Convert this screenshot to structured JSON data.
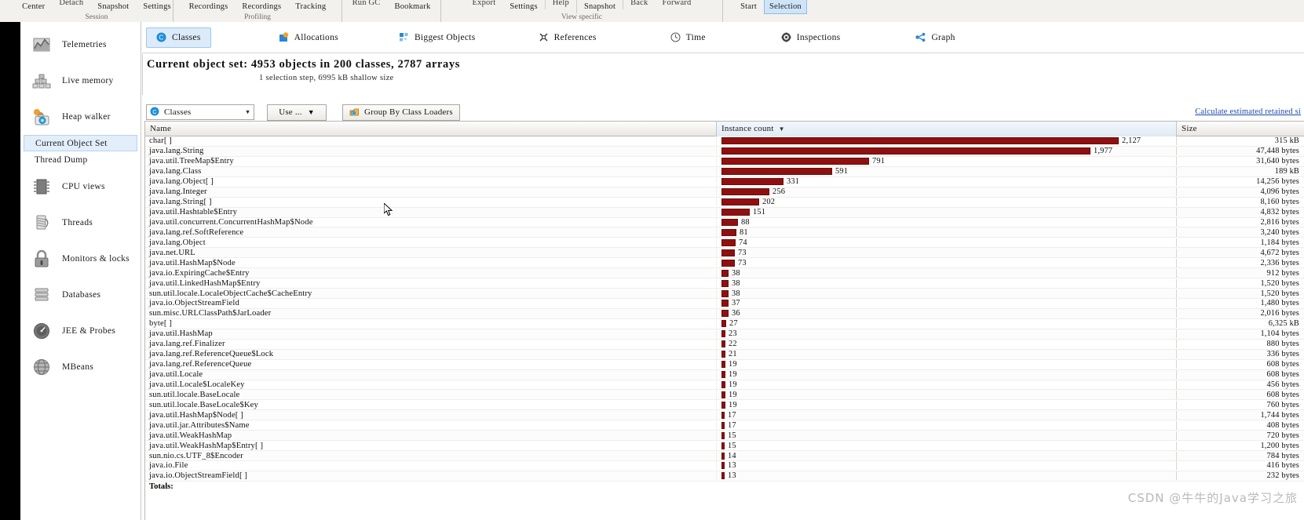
{
  "ribbon": {
    "groups": [
      {
        "label": "Session",
        "buttons": [
          "Center",
          "Detach",
          "Snapshot",
          "Settings"
        ]
      },
      {
        "label": "Profiling",
        "buttons": [
          "Recordings",
          "Recordings",
          "Tracking"
        ]
      },
      {
        "label": "",
        "buttons": [
          "Run GC",
          "Bookmark"
        ]
      },
      {
        "label": "View specific",
        "buttons": [
          "Export",
          "Settings",
          "Help",
          "Snapshot",
          "Back",
          "Forward"
        ]
      },
      {
        "label": "",
        "buttons": [
          "Start",
          "Selection"
        ]
      }
    ],
    "selected_button": "Selection"
  },
  "sidebar": {
    "items": [
      {
        "label": "Telemetries",
        "icon": "telemetries-icon"
      },
      {
        "label": "Live memory",
        "icon": "live-memory-icon"
      },
      {
        "label": "Heap walker",
        "icon": "heap-walker-icon"
      },
      {
        "label": "CPU views",
        "icon": "cpu-views-icon"
      },
      {
        "label": "Threads",
        "icon": "threads-icon"
      },
      {
        "label": "Monitors & locks",
        "icon": "monitors-locks-icon"
      },
      {
        "label": "Databases",
        "icon": "databases-icon"
      },
      {
        "label": "JEE & Probes",
        "icon": "jee-probes-icon"
      },
      {
        "label": "MBeans",
        "icon": "mbeans-icon"
      }
    ],
    "subitems": [
      {
        "label": "Current Object Set",
        "active": true
      },
      {
        "label": "Thread Dump",
        "active": false
      }
    ]
  },
  "tabs": [
    {
      "label": "Classes",
      "icon": "classes-icon",
      "active": true
    },
    {
      "label": "Allocations",
      "icon": "allocations-icon",
      "active": false
    },
    {
      "label": "Biggest Objects",
      "icon": "biggest-objects-icon",
      "active": false
    },
    {
      "label": "References",
      "icon": "references-icon",
      "active": false
    },
    {
      "label": "Time",
      "icon": "clock-icon",
      "active": false
    },
    {
      "label": "Inspections",
      "icon": "gear-icon",
      "active": false
    },
    {
      "label": "Graph",
      "icon": "graph-icon",
      "active": false
    }
  ],
  "header": {
    "title": "Current object set: 4953 objects in 200 classes, 2787 arrays",
    "subtitle": "1 selection step, 6995 kB shallow size"
  },
  "controls": {
    "view_select": {
      "value": "Classes",
      "icon": "class-icon"
    },
    "use_button": {
      "label": "Use ...",
      "icon": "chevron-down-icon"
    },
    "group_button": {
      "label": "Group By Class Loaders",
      "icon": "classloader-icon"
    },
    "calculate_link": "Calculate estimated retained si"
  },
  "table": {
    "columns": [
      "Name",
      "Instance count",
      "Size"
    ],
    "sort_column": "Instance count",
    "sort_direction": "desc",
    "max_count": 2127,
    "rows": [
      {
        "name": "char[ ]",
        "count": 2127,
        "count_label": "2,127",
        "size": "315 kB"
      },
      {
        "name": "java.lang.String",
        "count": 1977,
        "count_label": "1,977",
        "size": "47,448 bytes"
      },
      {
        "name": "java.util.TreeMap$Entry",
        "count": 791,
        "count_label": "791",
        "size": "31,640 bytes"
      },
      {
        "name": "java.lang.Class",
        "count": 591,
        "count_label": "591",
        "size": "189 kB"
      },
      {
        "name": "java.lang.Object[ ]",
        "count": 331,
        "count_label": "331",
        "size": "14,256 bytes"
      },
      {
        "name": "java.lang.Integer",
        "count": 256,
        "count_label": "256",
        "size": "4,096 bytes"
      },
      {
        "name": "java.lang.String[ ]",
        "count": 202,
        "count_label": "202",
        "size": "8,160 bytes"
      },
      {
        "name": "java.util.Hashtable$Entry",
        "count": 151,
        "count_label": "151",
        "size": "4,832 bytes"
      },
      {
        "name": "java.util.concurrent.ConcurrentHashMap$Node",
        "count": 88,
        "count_label": "88",
        "size": "2,816 bytes"
      },
      {
        "name": "java.lang.ref.SoftReference",
        "count": 81,
        "count_label": "81",
        "size": "3,240 bytes"
      },
      {
        "name": "java.lang.Object",
        "count": 74,
        "count_label": "74",
        "size": "1,184 bytes"
      },
      {
        "name": "java.net.URL",
        "count": 73,
        "count_label": "73",
        "size": "4,672 bytes"
      },
      {
        "name": "java.util.HashMap$Node",
        "count": 73,
        "count_label": "73",
        "size": "2,336 bytes"
      },
      {
        "name": "java.io.ExpiringCache$Entry",
        "count": 38,
        "count_label": "38",
        "size": "912 bytes"
      },
      {
        "name": "java.util.LinkedHashMap$Entry",
        "count": 38,
        "count_label": "38",
        "size": "1,520 bytes"
      },
      {
        "name": "sun.util.locale.LocaleObjectCache$CacheEntry",
        "count": 38,
        "count_label": "38",
        "size": "1,520 bytes"
      },
      {
        "name": "java.io.ObjectStreamField",
        "count": 37,
        "count_label": "37",
        "size": "1,480 bytes"
      },
      {
        "name": "sun.misc.URLClassPath$JarLoader",
        "count": 36,
        "count_label": "36",
        "size": "2,016 bytes"
      },
      {
        "name": "byte[ ]",
        "count": 27,
        "count_label": "27",
        "size": "6,325 kB"
      },
      {
        "name": "java.util.HashMap",
        "count": 23,
        "count_label": "23",
        "size": "1,104 bytes"
      },
      {
        "name": "java.lang.ref.Finalizer",
        "count": 22,
        "count_label": "22",
        "size": "880 bytes"
      },
      {
        "name": "java.lang.ref.ReferenceQueue$Lock",
        "count": 21,
        "count_label": "21",
        "size": "336 bytes"
      },
      {
        "name": "java.lang.ref.ReferenceQueue",
        "count": 19,
        "count_label": "19",
        "size": "608 bytes"
      },
      {
        "name": "java.util.Locale",
        "count": 19,
        "count_label": "19",
        "size": "608 bytes"
      },
      {
        "name": "java.util.Locale$LocaleKey",
        "count": 19,
        "count_label": "19",
        "size": "456 bytes"
      },
      {
        "name": "sun.util.locale.BaseLocale",
        "count": 19,
        "count_label": "19",
        "size": "608 bytes"
      },
      {
        "name": "sun.util.locale.BaseLocale$Key",
        "count": 19,
        "count_label": "19",
        "size": "760 bytes"
      },
      {
        "name": "java.util.HashMap$Node[ ]",
        "count": 17,
        "count_label": "17",
        "size": "1,744 bytes"
      },
      {
        "name": "java.util.jar.Attributes$Name",
        "count": 17,
        "count_label": "17",
        "size": "408 bytes"
      },
      {
        "name": "java.util.WeakHashMap",
        "count": 15,
        "count_label": "15",
        "size": "720 bytes"
      },
      {
        "name": "java.util.WeakHashMap$Entry[ ]",
        "count": 15,
        "count_label": "15",
        "size": "1,200 bytes"
      },
      {
        "name": "sun.nio.cs.UTF_8$Encoder",
        "count": 14,
        "count_label": "14",
        "size": "784 bytes"
      },
      {
        "name": "java.io.File",
        "count": 13,
        "count_label": "13",
        "size": "416 bytes"
      },
      {
        "name": "java.io.ObjectStreamField[ ]",
        "count": 13,
        "count_label": "13",
        "size": "232 bytes"
      }
    ],
    "totals_label": "Totals:"
  },
  "watermark": "CSDN @牛牛的Java学习之旅",
  "colors": {
    "bar": "#8f1010",
    "accent": "#dcebfa",
    "link": "#1b47a8"
  }
}
